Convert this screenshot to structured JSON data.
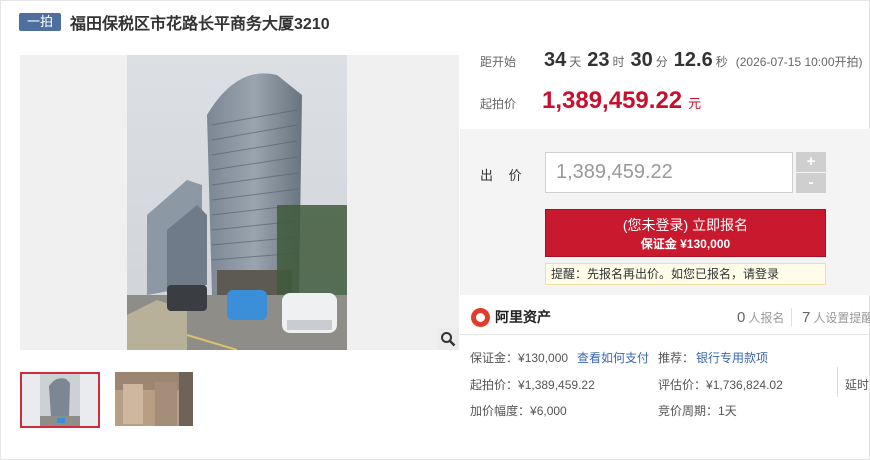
{
  "header": {
    "tag": "一拍",
    "title": "福田保税区市花路长平商务大厦3210"
  },
  "gallery": {
    "zoom_icon": "magnifier-icon"
  },
  "countdown": {
    "label": "距开始",
    "days": "34",
    "days_unit": "天",
    "hours": "23",
    "hours_unit": "时",
    "minutes": "30",
    "minutes_unit": "分",
    "seconds": "12.6",
    "seconds_unit": "秒",
    "start_time": "(2026-07-15 10:00开拍)"
  },
  "starting": {
    "label": "起拍价",
    "price": "1,389,459.22",
    "unit": "元"
  },
  "bid": {
    "label": "出 价",
    "value": "1,389,459.22",
    "plus": "+",
    "minus": "-",
    "register_main": "(您未登录) 立即报名",
    "register_sub": "保证金 ¥130,000",
    "notice": "提醒：先报名再出价。如您已报名，请登录"
  },
  "platform": {
    "name": "阿里资产",
    "signup_count": "0",
    "signup_label": "人报名",
    "reminder_count": "7",
    "reminder_label": "人设置提醒"
  },
  "details": {
    "deposit_label": "保证金：",
    "deposit_value": "¥130,000",
    "how_to_pay": "查看如何支付",
    "recommend_label": "推荐：",
    "recommend_link": "银行专用款项",
    "start_label": "起拍价：",
    "start_value": "¥1,389,459.22",
    "appraisal_label": "评估价：",
    "appraisal_value": "¥1,736,824.02",
    "delay_label": "延时",
    "increment_label": "加价幅度：",
    "increment_value": "¥6,000",
    "cycle_label": "竞价周期：",
    "cycle_value": "1天"
  },
  "colors": {
    "accent": "#c8192e",
    "tag": "#4f6f9f",
    "link": "#3a66b4"
  }
}
